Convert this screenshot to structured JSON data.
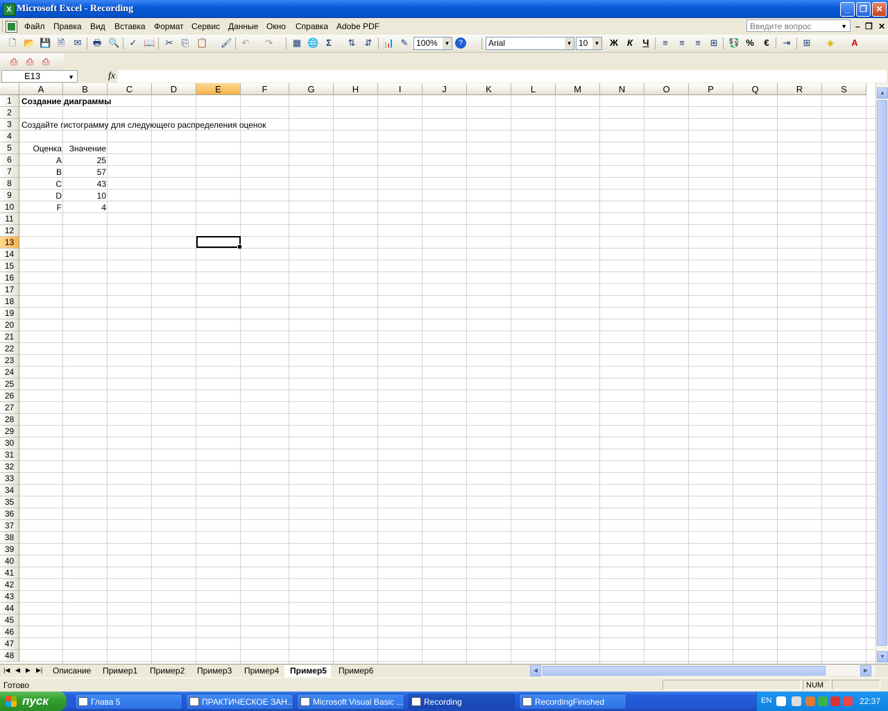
{
  "window": {
    "title": "Microsoft Excel - Recording",
    "app_icon": "X"
  },
  "menu": {
    "items": [
      "Файл",
      "Правка",
      "Вид",
      "Вставка",
      "Формат",
      "Сервис",
      "Данные",
      "Окно",
      "Справка",
      "Adobe PDF"
    ],
    "help_placeholder": "Введите вопрос"
  },
  "toolbar": {
    "zoom": "100%",
    "font": "Arial",
    "font_size": "10",
    "bold_label": "Ж",
    "italic_label": "К",
    "underline_label": "Ч",
    "sum_label": "Σ",
    "percent_label": "%",
    "euro_label": "€"
  },
  "formula_bar": {
    "name_box": "E13",
    "fx": "fx",
    "value": ""
  },
  "grid": {
    "columns": [
      "A",
      "B",
      "C",
      "D",
      "E",
      "F",
      "G",
      "H",
      "I",
      "J",
      "K",
      "L",
      "M",
      "N",
      "O",
      "P",
      "Q",
      "R",
      "S"
    ],
    "active_column": "E",
    "active_row": 13,
    "cells": {
      "title": "Создание диаграммы",
      "instruction": "Создайте гистограмму для следующего распределения оценок",
      "header_grade": "Оценка",
      "header_value": "Значение",
      "rows": [
        {
          "grade": "A",
          "value": "25"
        },
        {
          "grade": "B",
          "value": "57"
        },
        {
          "grade": "C",
          "value": "43"
        },
        {
          "grade": "D",
          "value": "10"
        },
        {
          "grade": "F",
          "value": "4"
        }
      ]
    }
  },
  "sheets": {
    "tabs": [
      "Описание",
      "Пример1",
      "Пример2",
      "Пример3",
      "Пример4",
      "Пример5",
      "Пример6"
    ],
    "active": "Пример5"
  },
  "status": {
    "text": "Готово",
    "num": "NUM"
  },
  "taskbar": {
    "start": "пуск",
    "buttons": [
      "Глава 5",
      "ПРАКТИЧЕСКОЕ ЗАН...",
      "Microsoft Visual Basic ...",
      "Recording",
      "RecordingFinished"
    ],
    "active": "Recording",
    "lang": "EN",
    "clock": "22:37"
  }
}
